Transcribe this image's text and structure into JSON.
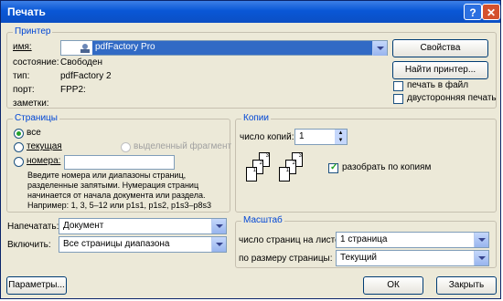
{
  "window": {
    "title": "Печать",
    "help": "?",
    "close": "✕"
  },
  "printer": {
    "section": "Принтер",
    "name_label": "имя:",
    "name_value": "pdfFactory Pro",
    "properties_btn": "Свойства",
    "find_btn": "Найти принтер...",
    "status_label": "состояние:",
    "status_value": "Свободен",
    "type_label": "тип:",
    "type_value": "pdfFactory 2",
    "port_label": "порт:",
    "port_value": "FPP2:",
    "notes_label": "заметки:",
    "print_to_file": "печать в файл",
    "duplex": "двусторонняя печать"
  },
  "pages": {
    "section": "Страницы",
    "all": "все",
    "current": "текущая",
    "selection": "выделенный фрагмент",
    "numbers": "номера:",
    "hint": [
      "Введите номера или диапазоны страниц,",
      "разделенные запятыми. Нумерация страниц",
      "начинается от начала документа или раздела.",
      "Например: 1, 3, 5–12 или p1s1, p1s2, p1s3–p8s3"
    ]
  },
  "copies": {
    "section": "Копии",
    "count_label": "число копий:",
    "count_value": "1",
    "collate": "разобрать по копиям",
    "page_nums": [
      "3",
      "2",
      "1",
      "3",
      "2",
      "1"
    ]
  },
  "print_what": {
    "label": "Напечатать:",
    "value": "Документ"
  },
  "include": {
    "label": "Включить:",
    "value": "Все страницы диапазона"
  },
  "zoom": {
    "section": "Масштаб",
    "pages_per_sheet_label": "число страниц на листе:",
    "pages_per_sheet_value": "1 страница",
    "scale_label": "по размеру страницы:",
    "scale_value": "Текущий"
  },
  "footer": {
    "options": "Параметры...",
    "ok": "ОК",
    "close": "Закрыть"
  }
}
